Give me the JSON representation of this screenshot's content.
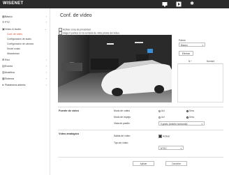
{
  "header": {
    "logo": "WISENET"
  },
  "sidebar": {
    "items": [
      {
        "label": "Básico",
        "icon": "grid-icon"
      },
      {
        "label": "PTZ",
        "icon": "move-icon"
      },
      {
        "label": "Vídeo & Audio",
        "icon": "video-icon"
      },
      {
        "label": "Red",
        "icon": "network-icon"
      },
      {
        "label": "Evento",
        "icon": "event-icon"
      },
      {
        "label": "Analítica",
        "icon": "analytics-icon"
      },
      {
        "label": "Sistema",
        "icon": "system-icon"
      },
      {
        "label": "Plataforma abierta",
        "icon": "platform-icon"
      }
    ],
    "subitems": [
      {
        "label": "Conf. de vídeo",
        "active": true
      },
      {
        "label": "Configuración de audio",
        "active": false
      },
      {
        "label": "Configuración de cámara",
        "active": false
      },
      {
        "label": "Smart codec",
        "active": false
      },
      {
        "label": "Wisestream",
        "active": false
      }
    ]
  },
  "main": {
    "title": "Conf. de vídeo",
    "privacy_checkbox": "Activar zona de privacidad",
    "privacy_hint": "Haga 4 puntos en la ventana de vista previa del vídeo.",
    "patron_label": "Patrón",
    "patron_value": "Blanco",
    "delete_button": "Eliminar",
    "table_headers": [
      "N.º",
      "Nombre"
    ],
    "video_source": {
      "title": "Fuente de vídeo",
      "rows": [
        {
          "label": "Modo de volteo",
          "options": [
            "Act",
            "Desc"
          ],
          "selected": 1
        },
        {
          "label": "Modo de espejo",
          "options": [
            "Act",
            "Desc"
          ],
          "selected": 1
        }
      ],
      "hallway_label": "Vista de pasillo",
      "hallway_value": "0 grado (Ambito horizontal)"
    },
    "analog": {
      "title": "Vídeo analógico",
      "output_label": "Salida de vídeo",
      "output_checkbox": "Activar",
      "type_label": "Tipo de vídeo",
      "type_value": "NTSC"
    },
    "apply_button": "Aplicar",
    "cancel_button": "Cancelar"
  }
}
